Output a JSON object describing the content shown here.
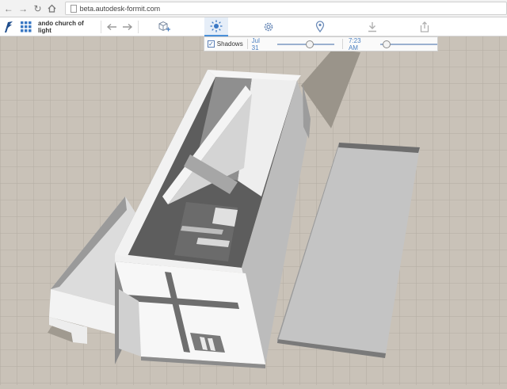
{
  "browser": {
    "url": "beta.autodesk-formit.com"
  },
  "toolbar": {
    "project_title": "ando church of light"
  },
  "icons": {
    "logo": "formit-logo-icon",
    "grid": "grid-menu-icon",
    "undo": "undo-arrow-icon",
    "redo": "redo-arrow-icon",
    "add_object": "add-3d-object-icon",
    "sun": "sun-icon",
    "settings": "gear-icon",
    "location": "map-pin-icon",
    "download": "download-icon",
    "share": "share-icon"
  },
  "shadows": {
    "label": "Shadows",
    "checked": true,
    "date": "Jul 31",
    "date_fraction": 0.57,
    "time": "7:23 AM",
    "time_fraction": 0.1
  },
  "colors": {
    "ground": "#c9c2b8",
    "grid_line": "#b3aca2",
    "accent": "#4a90d9"
  }
}
